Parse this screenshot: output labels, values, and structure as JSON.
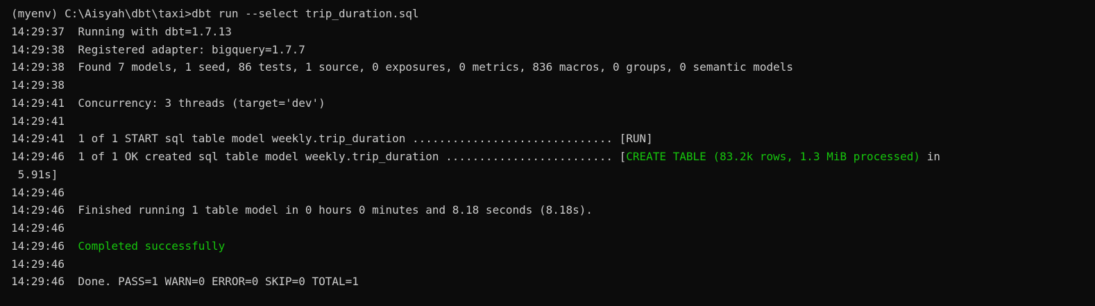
{
  "window": {
    "title": ""
  },
  "colors": {
    "background": "#0c0c0c",
    "text": "#cccccc",
    "success": "#16c60c"
  },
  "terminal": {
    "prompt_line": "(myenv) C:\\Aisyah\\dbt\\taxi>dbt run --select trip_duration.sql",
    "lines": [
      {
        "ts": "14:29:37",
        "text": "Running with dbt=1.7.13"
      },
      {
        "ts": "14:29:38",
        "text": "Registered adapter: bigquery=1.7.7"
      },
      {
        "ts": "14:29:38",
        "text": "Found 7 models, 1 seed, 86 tests, 1 source, 0 exposures, 0 metrics, 836 macros, 0 groups, 0 semantic models"
      },
      {
        "ts": "14:29:38",
        "text": ""
      },
      {
        "ts": "14:29:41",
        "text": "Concurrency: 3 threads (target='dev')"
      },
      {
        "ts": "14:29:41",
        "text": ""
      },
      {
        "ts": "14:29:41",
        "text": "1 of 1 START sql table model weekly.trip_duration .............................. [RUN]"
      },
      {
        "ts": "14:29:46",
        "text_prefix": "1 of 1 OK created sql table model weekly.trip_duration ......................... [",
        "text_green": "CREATE TABLE (83.2k rows, 1.3 MiB processed)",
        "text_suffix": " in"
      },
      {
        "ts": "",
        "text": " 5.91s]"
      },
      {
        "ts": "14:29:46",
        "text": ""
      },
      {
        "ts": "14:29:46",
        "text": "Finished running 1 table model in 0 hours 0 minutes and 8.18 seconds (8.18s)."
      },
      {
        "ts": "14:29:46",
        "text": ""
      },
      {
        "ts": "14:29:46",
        "text_green": "Completed successfully"
      },
      {
        "ts": "14:29:46",
        "text": ""
      },
      {
        "ts": "14:29:46",
        "text": "Done. PASS=1 WARN=0 ERROR=0 SKIP=0 TOTAL=1"
      }
    ]
  }
}
